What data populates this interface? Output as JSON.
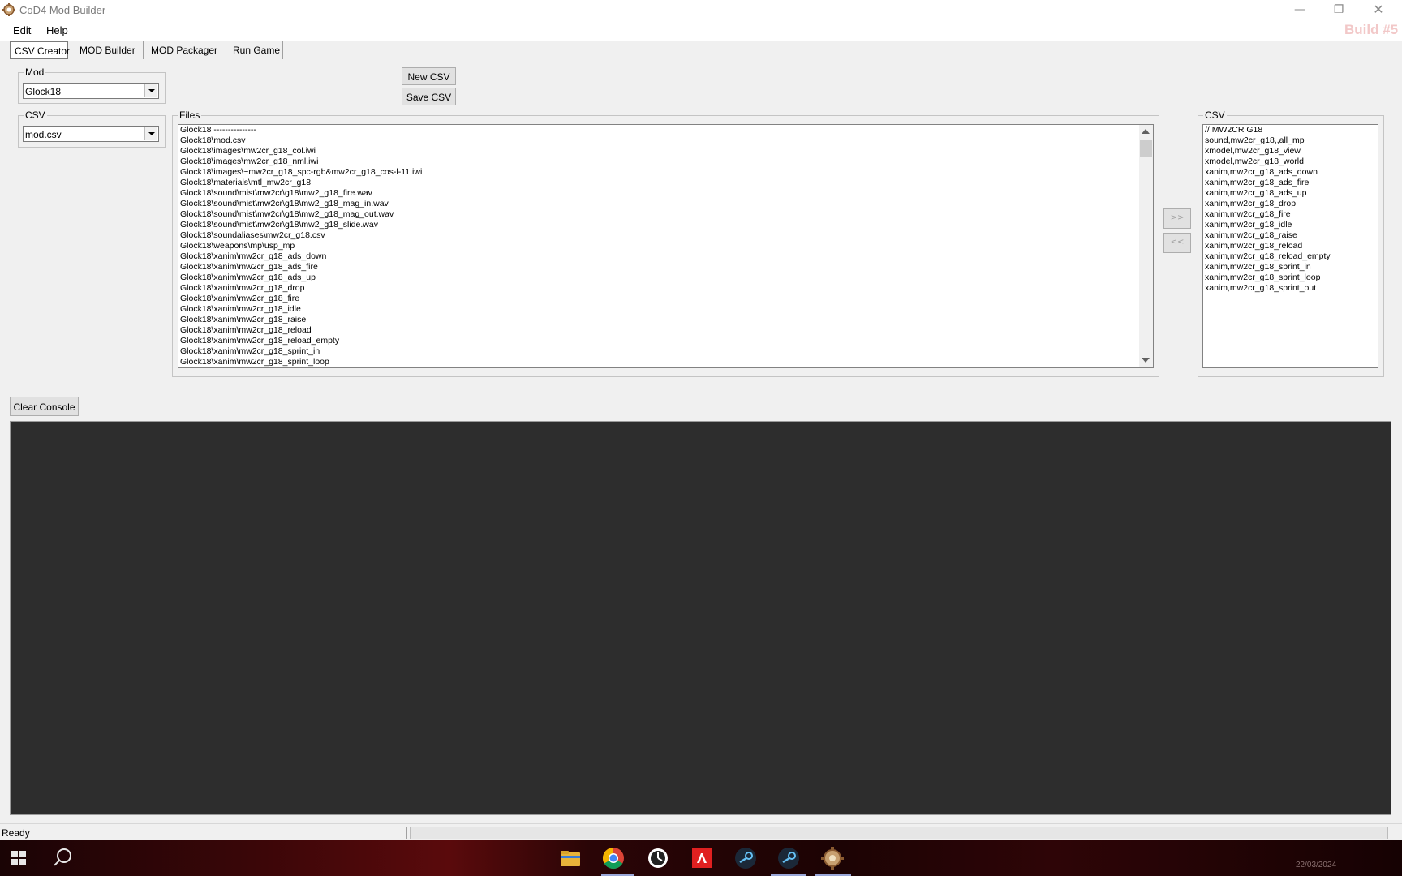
{
  "window": {
    "title": "CoD4 Mod Builder",
    "controls": {
      "minimize": "—",
      "maximize": "❐",
      "close": "✕"
    },
    "build_label": "Build #5"
  },
  "menu": [
    "Edit",
    "Help"
  ],
  "tabs": [
    "CSV Creator",
    "MOD Builder",
    "MOD Packager",
    "Run Game"
  ],
  "mod_group": {
    "legend": "Mod",
    "value": "Glock18"
  },
  "csv_group": {
    "legend": "CSV",
    "value": "mod.csv"
  },
  "buttons": {
    "new_csv": "New CSV",
    "save_csv": "Save CSV",
    "add": ">>",
    "remove": "<<",
    "clear_console": "Clear Console"
  },
  "files": {
    "legend": "Files",
    "items": [
      "Glock18 ---------------",
      "Glock18\\mod.csv",
      "Glock18\\images\\mw2cr_g18_col.iwi",
      "Glock18\\images\\mw2cr_g18_nml.iwi",
      "Glock18\\images\\~mw2cr_g18_spc-rgb&mw2cr_g18_cos-l-11.iwi",
      "Glock18\\materials\\mtl_mw2cr_g18",
      "Glock18\\sound\\mist\\mw2cr\\g18\\mw2_g18_fire.wav",
      "Glock18\\sound\\mist\\mw2cr\\g18\\mw2_g18_mag_in.wav",
      "Glock18\\sound\\mist\\mw2cr\\g18\\mw2_g18_mag_out.wav",
      "Glock18\\sound\\mist\\mw2cr\\g18\\mw2_g18_slide.wav",
      "Glock18\\soundaliases\\mw2cr_g18.csv",
      "Glock18\\weapons\\mp\\usp_mp",
      "Glock18\\xanim\\mw2cr_g18_ads_down",
      "Glock18\\xanim\\mw2cr_g18_ads_fire",
      "Glock18\\xanim\\mw2cr_g18_ads_up",
      "Glock18\\xanim\\mw2cr_g18_drop",
      "Glock18\\xanim\\mw2cr_g18_fire",
      "Glock18\\xanim\\mw2cr_g18_idle",
      "Glock18\\xanim\\mw2cr_g18_raise",
      "Glock18\\xanim\\mw2cr_g18_reload",
      "Glock18\\xanim\\mw2cr_g18_reload_empty",
      "Glock18\\xanim\\mw2cr_g18_sprint_in",
      "Glock18\\xanim\\mw2cr_g18_sprint_loop"
    ]
  },
  "csv_list": {
    "legend": "CSV",
    "items": [
      "// MW2CR G18",
      "sound,mw2cr_g18,,all_mp",
      "xmodel,mw2cr_g18_view",
      "xmodel,mw2cr_g18_world",
      "xanim,mw2cr_g18_ads_down",
      "xanim,mw2cr_g18_ads_fire",
      "xanim,mw2cr_g18_ads_up",
      "xanim,mw2cr_g18_drop",
      "xanim,mw2cr_g18_fire",
      "xanim,mw2cr_g18_idle",
      "xanim,mw2cr_g18_raise",
      "xanim,mw2cr_g18_reload",
      "xanim,mw2cr_g18_reload_empty",
      "xanim,mw2cr_g18_sprint_in",
      "xanim,mw2cr_g18_sprint_loop",
      "xanim,mw2cr_g18_sprint_out"
    ]
  },
  "status": {
    "text": "Ready"
  },
  "taskbar": {
    "apps": [
      "file-explorer",
      "chrome",
      "clock-app",
      "amd-software",
      "steam",
      "steam",
      "mod-builder"
    ],
    "clock": "22/03/2024"
  },
  "colors": {
    "console_bg": "#2d2d2d",
    "window_bg": "#f0f0f0",
    "build_label": "#f2c8c8"
  }
}
